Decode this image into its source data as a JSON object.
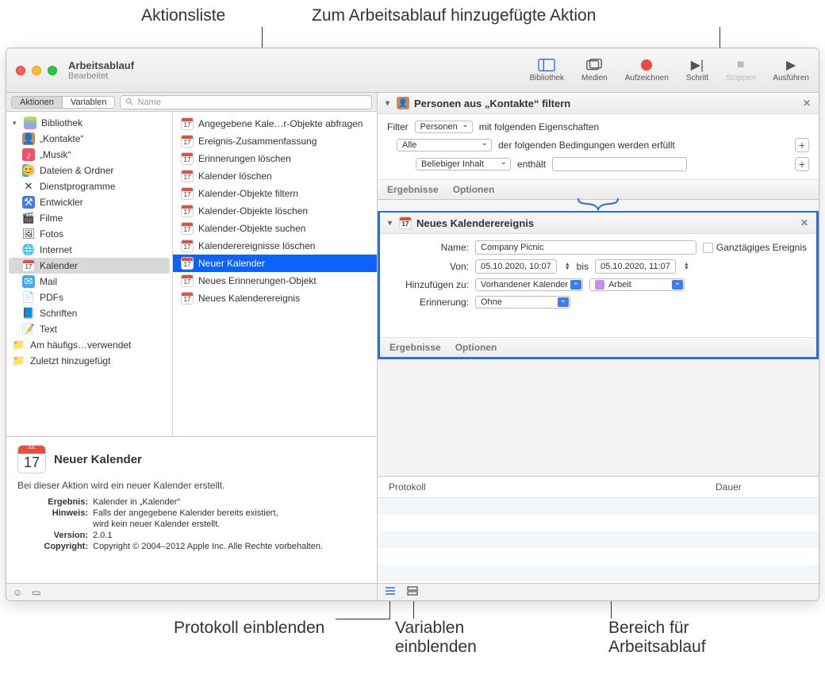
{
  "callouts": {
    "top_left": "Aktionsliste",
    "top_right": "Zum Arbeitsablauf hinzugefügte Aktion",
    "bottom_left": "Protokoll einblenden",
    "bottom_mid": "Variablen\neinblenden",
    "bottom_right": "Bereich für\nArbeitsablauf"
  },
  "window": {
    "title": "Arbeitsablauf",
    "subtitle": "Bearbeitet"
  },
  "toolbar": {
    "library": "Bibliothek",
    "media": "Medien",
    "record": "Aufzeichnen",
    "step": "Schritt",
    "stop": "Stoppen",
    "run": "Ausführen"
  },
  "seg": {
    "actions": "Aktionen",
    "vars": "Variablen"
  },
  "search": {
    "placeholder": "Name"
  },
  "sidebar": {
    "library": "Bibliothek",
    "items": [
      "„Kontakte“",
      "„Musik“",
      "Dateien & Ordner",
      "Dienstprogramme",
      "Entwickler",
      "Filme",
      "Fotos",
      "Internet",
      "Kalender",
      "Mail",
      "PDFs",
      "Schriften",
      "Text"
    ],
    "recent1": "Am häufigs…verwendet",
    "recent2": "Zuletzt hinzugefügt"
  },
  "actions": [
    "Angegebene Kale…r-Objekte abfragen",
    "Ereignis-Zusammenfassung",
    "Erinnerungen löschen",
    "Kalender löschen",
    "Kalender-Objekte filtern",
    "Kalender-Objekte löschen",
    "Kalender-Objekte suchen",
    "Kalenderereignisse löschen",
    "Neuer Kalender",
    "Neues Erinnerungen-Objekt",
    "Neues Kalenderereignis"
  ],
  "info": {
    "title": "Neuer Kalender",
    "desc": "Bei dieser Aktion wird ein neuer Kalender erstellt.",
    "result_k": "Ergebnis:",
    "result_v": "Kalender in „Kalender“",
    "note_k": "Hinweis:",
    "note_v": "Falls der angegebene Kalender bereits existiert,",
    "note_v2": "wird kein neuer Kalender erstellt.",
    "version_k": "Version:",
    "version_v": "2.0.1",
    "copyright_k": "Copyright:",
    "copyright_v": "Copyright © 2004–2012 Apple Inc. Alle Rechte vorbehalten."
  },
  "card1": {
    "title": "Personen aus „Kontakte“ filtern",
    "filter_label": "Filter",
    "filter_val": "Personen",
    "filter_tail": "mit folgenden Eigenschaften",
    "cond_scope": "Alle",
    "cond_tail": "der folgenden Bedingungen werden erfüllt",
    "any_content": "Beliebiger Inhalt",
    "contains": "enthält",
    "results": "Ergebnisse",
    "options": "Optionen"
  },
  "card2": {
    "title": "Neues Kalenderereignis",
    "name_k": "Name:",
    "name_v": "Company Picnic",
    "allday": "Ganztägiges Ereignis",
    "from_k": "Von:",
    "from_v": "05.10.2020, 10:07",
    "to_k": "bis",
    "to_v": "05.10.2020, 11:07",
    "addto_k": "Hinzufügen zu:",
    "addto_v": "Vorhandener Kalender",
    "cal_name": "Arbeit",
    "remind_k": "Erinnerung:",
    "remind_v": "Ohne",
    "results": "Ergebnisse",
    "options": "Optionen"
  },
  "log": {
    "col1": "Protokoll",
    "col2": "Dauer"
  },
  "colors": {
    "accent": "#0a63ff",
    "cal_red": "#e74c3c",
    "cal_work": "#c48fef"
  }
}
